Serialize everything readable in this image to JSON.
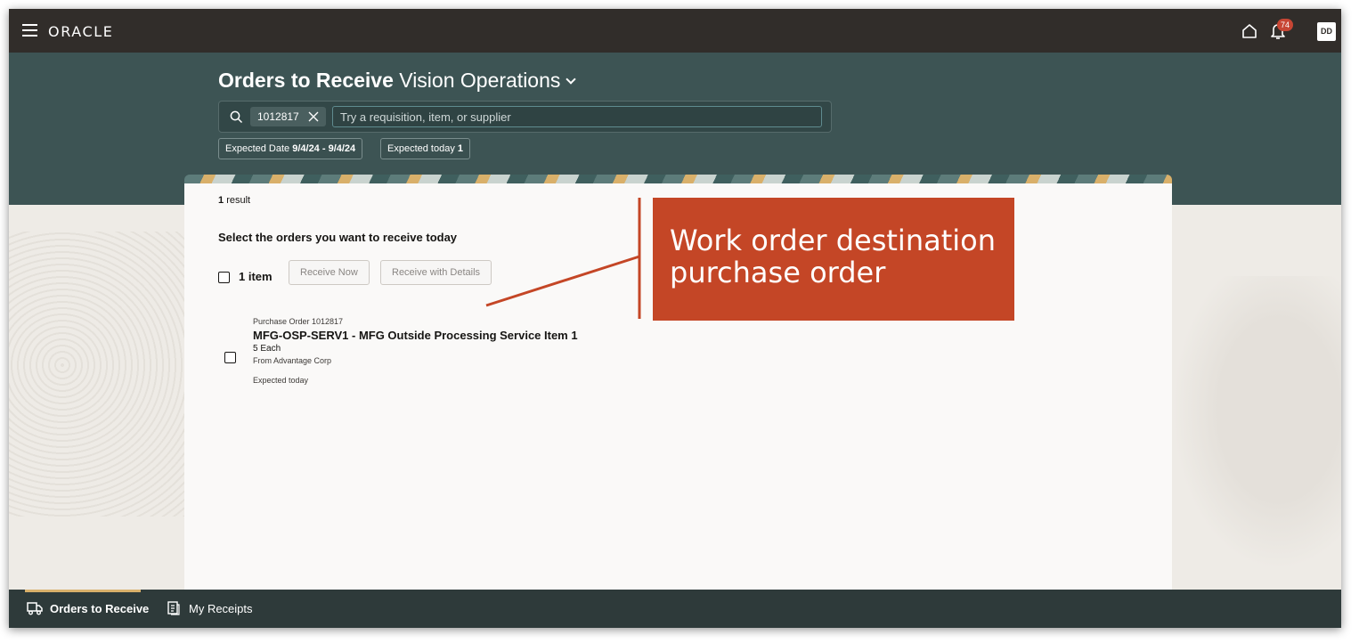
{
  "header": {
    "logo": "ORACLE",
    "notification_count": "74",
    "user_initials": "DD"
  },
  "page": {
    "title_bold": "Orders to Receive",
    "title_org": "Vision Operations"
  },
  "search": {
    "chip_value": "1012817",
    "placeholder": "Try a requisition, item, or supplier"
  },
  "filters": [
    {
      "label": "Expected Date",
      "value": "9/4/24 - 9/4/24"
    },
    {
      "label": "Expected today",
      "value": "1"
    }
  ],
  "results": {
    "count": "1",
    "count_label": "result",
    "section_title": "Select the orders you want to receive today",
    "item_count_label": "1 item",
    "receive_now_label": "Receive Now",
    "receive_details_label": "Receive with Details",
    "orders": [
      {
        "po_label": "Purchase Order 1012817",
        "title": "MFG-OSP-SERV1 - MFG Outside Processing Service Item 1",
        "quantity": "5 Each",
        "supplier": "From Advantage Corp",
        "expected": "Expected today"
      }
    ]
  },
  "callout": {
    "line1": "Work order destination",
    "line2": "purchase order",
    "color": "#c44626"
  },
  "bottom_nav": {
    "items": [
      {
        "label": "Orders to Receive",
        "icon": "truck-icon",
        "active": true
      },
      {
        "label": "My Receipts",
        "icon": "receipt-icon",
        "active": false
      }
    ]
  },
  "colors": {
    "topbar": "#312d2a",
    "banner": "#3d5454",
    "badge": "#c74634",
    "accent": "#d9b06a"
  }
}
